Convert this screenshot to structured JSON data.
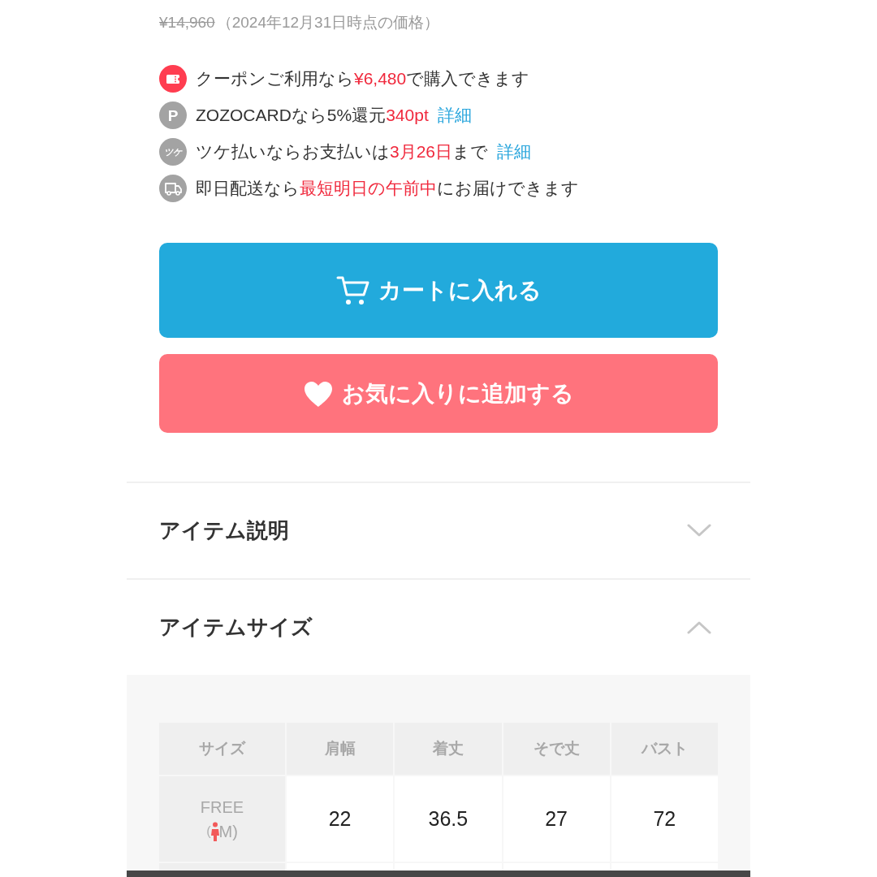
{
  "price": {
    "original": "¥14,960",
    "note": "（2024年12月31日時点の価格）"
  },
  "benefits": [
    {
      "kind": "coupon",
      "segments": [
        {
          "text": "クーポンご利用なら",
          "highlight": false
        },
        {
          "text": "¥6,480",
          "highlight": true
        },
        {
          "text": "で購入できます",
          "highlight": false
        }
      ]
    },
    {
      "kind": "points",
      "mark": "P",
      "segments": [
        {
          "text": "ZOZOCARDなら5%還元",
          "highlight": false
        },
        {
          "text": "340pt",
          "highlight": true
        }
      ],
      "link": "詳細"
    },
    {
      "kind": "tsuke",
      "mark": "ツケ",
      "segments": [
        {
          "text": "ツケ払いならお支払いは",
          "highlight": false
        },
        {
          "text": "3月26日",
          "highlight": true
        },
        {
          "text": "まで",
          "highlight": false
        }
      ],
      "link": "詳細"
    },
    {
      "kind": "delivery",
      "segments": [
        {
          "text": "即日配送なら",
          "highlight": false
        },
        {
          "text": "最短明日の午前中",
          "highlight": true
        },
        {
          "text": "にお届けできます",
          "highlight": false
        }
      ]
    }
  ],
  "buttons": [
    {
      "kind": "cart",
      "label": "カートに入れる"
    },
    {
      "kind": "favorite",
      "label": "お気に入りに追加する"
    }
  ],
  "sections": [
    {
      "title": "アイテム説明",
      "expanded": false
    },
    {
      "title": "アイテムサイズ",
      "expanded": true,
      "size_table": {
        "columns": [
          "サイズ",
          "肩幅",
          "着丈",
          "そで丈",
          "バスト"
        ],
        "rows": [
          {
            "size": "FREE",
            "model": {
              "open": "(",
              "label": "M)"
            },
            "values": [
              "22",
              "36.5",
              "27",
              "72"
            ]
          }
        ]
      }
    }
  ]
}
